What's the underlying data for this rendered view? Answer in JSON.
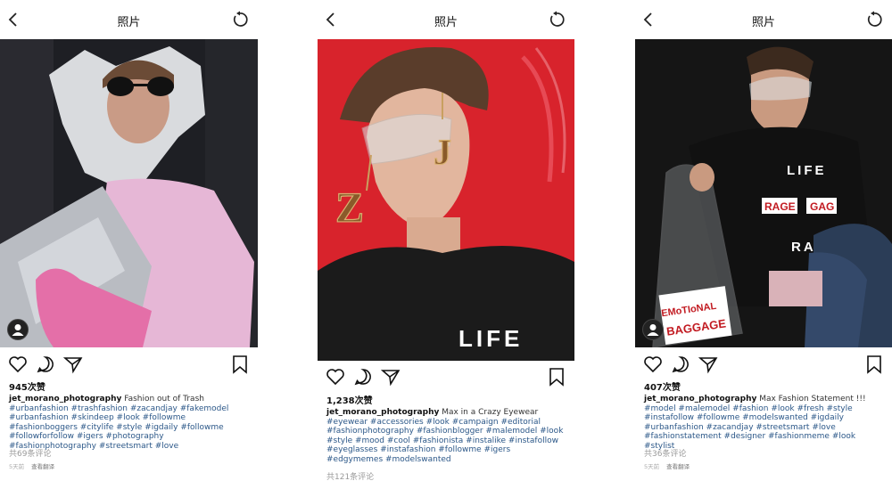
{
  "header_title": "照片",
  "panels": [
    {
      "likes": "945次赞",
      "username": "jet_morano_photography",
      "caption_text": "Fashion out of Trash",
      "hashtags": "#urbanfashion #trashfashion #zacandjay #fakemodel #urbanfashion #skindeep #look #followme #fashionboggers #citylife #style #igdaily #followme #followforfollow #igers #photography #fashionphotography #streetsmart #love",
      "comments": "共69条评论",
      "time_ago": "5天前",
      "view_translation": "查看翻译"
    },
    {
      "likes": "1,238次赞",
      "username": "jet_morano_photography",
      "caption_text": "Max in a Crazy Eyewear",
      "hashtags": "#eyewear #accessories #look #campaign #editorial #fashionphotography #fashionblogger #malemodel #look #style #mood #cool #fashionista #instalike #instafollow #eyeglasses #instafashion #followme #igers #edgymemes #modelswanted",
      "comments": "共121条评论",
      "time_ago": "",
      "view_translation": ""
    },
    {
      "likes": "407次赞",
      "username": "jet_morano_photography",
      "caption_text": "Max Fashion Statement !!!",
      "hashtags": "#model #malemodel #fashion #look #fresh #style #instafollow #followme #modelswanted #igdaily #urbanfashion #zacandjay #streetsmart #love #fashionstatement #designer #fashionmeme #look #stylist",
      "comments": "共36条评论",
      "time_ago": "5天前",
      "view_translation": "查看翻译"
    }
  ],
  "photo_text": {
    "p2_shirt": "LIFE",
    "p2_earring_left": "Z",
    "p2_earring_right": "J",
    "p3_shirt_line1": "LIFE",
    "p3_shirt_line2a": "RAGE",
    "p3_shirt_line2b": "GAG",
    "p3_shirt_line3": "RA",
    "p3_bag_line1": "EMoTIoNAL",
    "p3_bag_line2": "BAGGAGE"
  },
  "icons": {
    "back": "chevron-left-icon",
    "refresh": "refresh-icon",
    "like": "heart-icon",
    "comment": "comment-icon",
    "share": "paper-plane-icon",
    "save": "bookmark-icon",
    "user": "user-icon"
  },
  "colors": {
    "hashtag": "#2b5788",
    "bg_red": "#d8232c",
    "bg_dark": "#1b1b1b"
  }
}
